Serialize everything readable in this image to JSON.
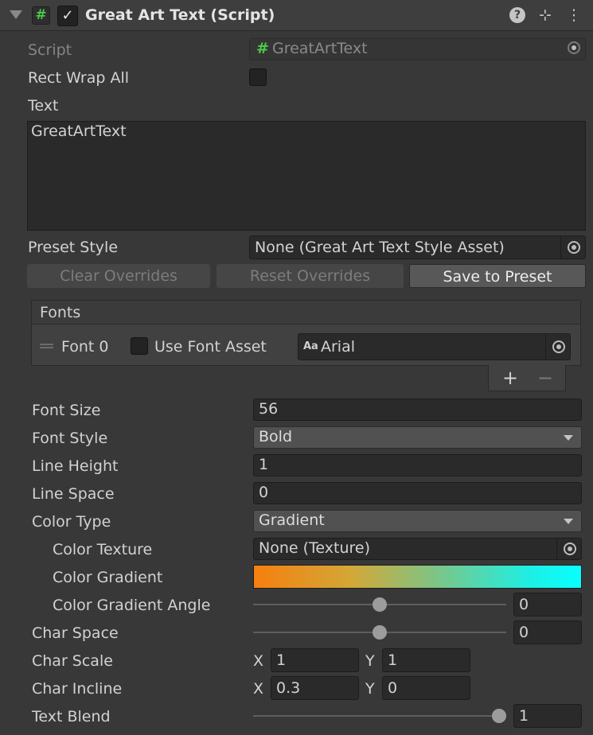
{
  "header": {
    "title": "Great Art Text (Script)",
    "enabled_check": "✓",
    "script_icon": "#",
    "help_icon": "?",
    "presets_icon": "⊹",
    "more_icon": "⋮"
  },
  "fields": {
    "script": {
      "label": "Script",
      "value": "GreatArtText"
    },
    "rect_wrap_all": {
      "label": "Rect Wrap All",
      "checked": false
    },
    "text": {
      "label": "Text",
      "value": "GreatArtText"
    },
    "preset_style": {
      "label": "Preset Style",
      "value": "None (Great Art Text Style Asset)"
    }
  },
  "buttons": {
    "clear_overrides": "Clear Overrides",
    "reset_overrides": "Reset Overrides",
    "save_to_preset": "Save to Preset"
  },
  "fonts": {
    "header": "Fonts",
    "item_label": "Font 0",
    "use_font_asset_label": "Use Font Asset",
    "use_font_asset_checked": false,
    "font_icon": "Aa",
    "font_value": "Arial",
    "add": "+",
    "remove": "−"
  },
  "props": {
    "font_size": {
      "label": "Font Size",
      "value": "56"
    },
    "font_style": {
      "label": "Font Style",
      "value": "Bold"
    },
    "line_height": {
      "label": "Line Height",
      "value": "1"
    },
    "line_space": {
      "label": "Line Space",
      "value": "0"
    },
    "color_type": {
      "label": "Color Type",
      "value": "Gradient"
    },
    "color_texture": {
      "label": "Color Texture",
      "value": "None (Texture)"
    },
    "color_gradient": {
      "label": "Color Gradient",
      "colors": [
        "#f57f0f",
        "#08ffff"
      ]
    },
    "color_gradient_angle": {
      "label": "Color Gradient Angle",
      "value": "0",
      "fraction": 0.5
    },
    "char_space": {
      "label": "Char Space",
      "value": "0",
      "fraction": 0.5
    },
    "char_scale": {
      "label": "Char Scale",
      "x_label": "X",
      "x": "1",
      "y_label": "Y",
      "y": "1"
    },
    "char_incline": {
      "label": "Char Incline",
      "x_label": "X",
      "x": "0.3",
      "y_label": "Y",
      "y": "0"
    },
    "text_blend": {
      "label": "Text Blend",
      "value": "1",
      "fraction": 1.0
    }
  }
}
